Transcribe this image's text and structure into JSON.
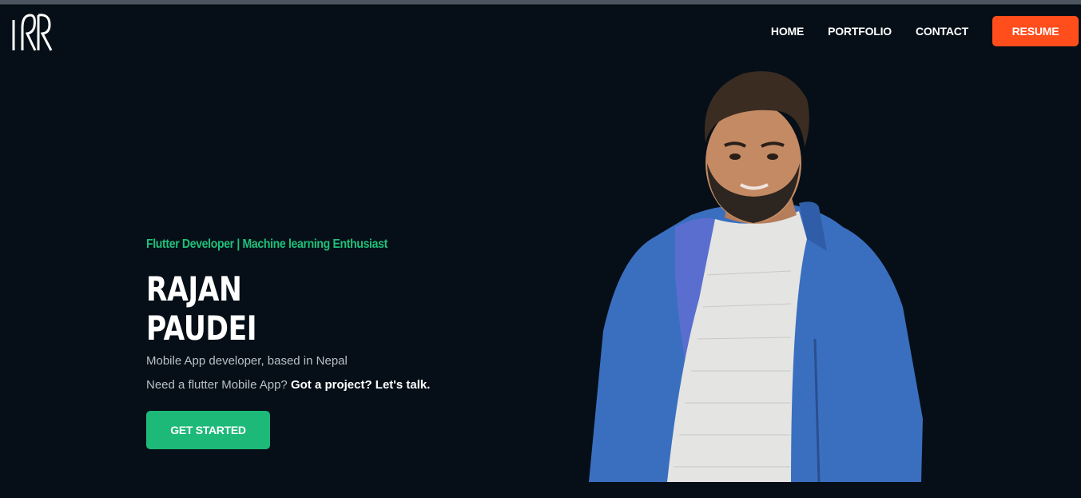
{
  "nav": {
    "logo_text": "RR",
    "items": [
      {
        "label": "HOME"
      },
      {
        "label": "PORTFOLIO"
      },
      {
        "label": "CONTACT"
      }
    ],
    "resume_label": "RESUME"
  },
  "hero": {
    "tagline": "Flutter Developer | Machine learning Enthusiast",
    "name_line1": "RAJAN",
    "name_line2": "PAUDEI",
    "description": "Mobile App developer, based in Nepal",
    "cta_prefix": "Need a flutter Mobile App? ",
    "cta_strong": "Got a project? Let's talk.",
    "button_label": "GET STARTED"
  },
  "colors": {
    "background": "#060f17",
    "accent_green": "#1ec07a",
    "resume_orange": "#ff4d1c",
    "jacket_blue": "#3a6fc0"
  }
}
